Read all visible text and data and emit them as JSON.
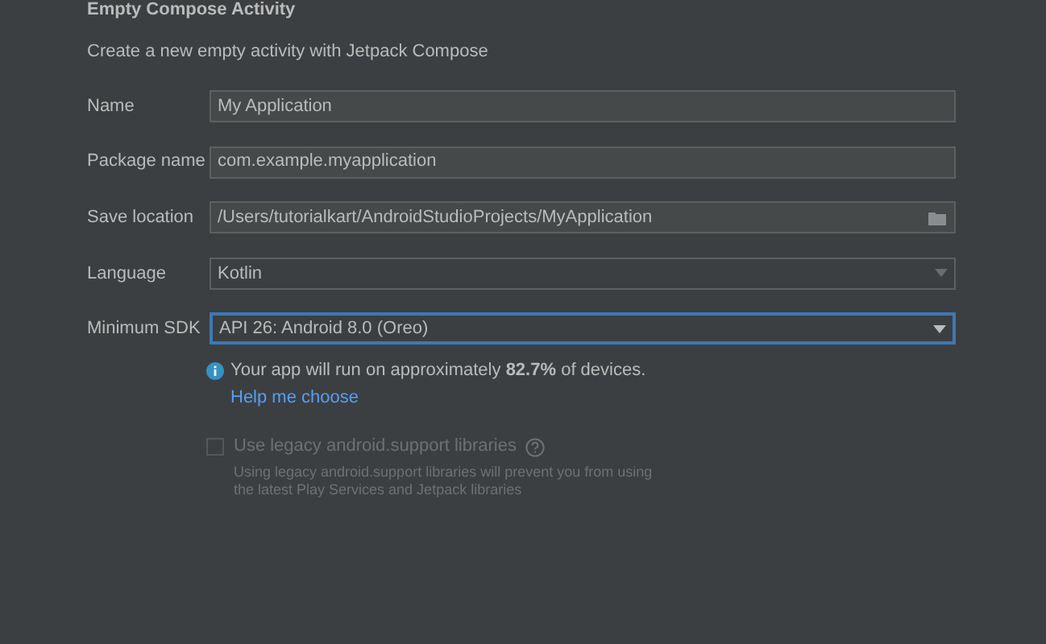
{
  "title": "Empty Compose Activity",
  "subtitle": "Create a new empty activity with Jetpack Compose",
  "fields": [
    {
      "label": "Name",
      "value": "My Application",
      "kind": "text",
      "focused": false
    },
    {
      "label": "Package name",
      "value": "com.example.myapplication",
      "kind": "text",
      "focused": false
    },
    {
      "label": "Save location",
      "value": "/Users/tutorialkart/AndroidStudioProjects/MyApplication",
      "kind": "path",
      "focused": false
    },
    {
      "label": "Language",
      "value": "Kotlin",
      "kind": "dropdown",
      "focused": false
    },
    {
      "label": "Minimum SDK",
      "value": "API 26: Android 8.0 (Oreo)",
      "kind": "dropdown",
      "focused": true
    }
  ],
  "info": {
    "text": "Your app will run on approximately **82.7%** of devices.",
    "link": "Help me choose"
  },
  "legacy": {
    "label": "Use legacy android.support libraries",
    "checked": false,
    "disabled": true,
    "description": "Using legacy android.support libraries will prevent you from using the latest Play Services and Jetpack libraries"
  }
}
